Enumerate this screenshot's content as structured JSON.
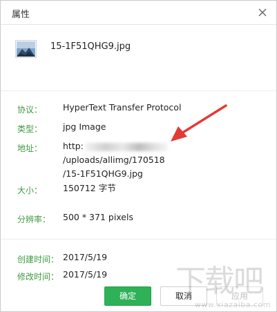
{
  "dialog": {
    "title": "属性",
    "close_icon": "close-icon"
  },
  "file": {
    "name": "15-1F51QHG9.jpg",
    "thumb_icon": "image-thumbnail-icon"
  },
  "props": {
    "protocol": {
      "label": "协议：",
      "value": "HyperText Transfer Protocol"
    },
    "type": {
      "label": "类型：",
      "value": "jpg Image"
    },
    "address": {
      "label": "地址：",
      "value_prefix": "http:",
      "value_suffix": "/uploads/allimg/170518",
      "value_line2": "/15-1F51QHG9.jpg"
    },
    "size": {
      "label": "大小：",
      "value": "150712 字节"
    },
    "resolution": {
      "label": "分辨率：",
      "value": "500 * 371 pixels"
    },
    "created": {
      "label": "创建时间：",
      "value": "2017/5/19"
    },
    "modified": {
      "label": "修改时间：",
      "value": "2017/5/19"
    }
  },
  "buttons": {
    "ok": "确定",
    "cancel": "取消",
    "apply": "应用"
  },
  "watermark": {
    "text": "下载吧",
    "url": "www.xiazaiba.com"
  },
  "colors": {
    "label_green": "#3f9a3f",
    "ok_button": "#2eb157",
    "arrow_red": "#e53935"
  }
}
